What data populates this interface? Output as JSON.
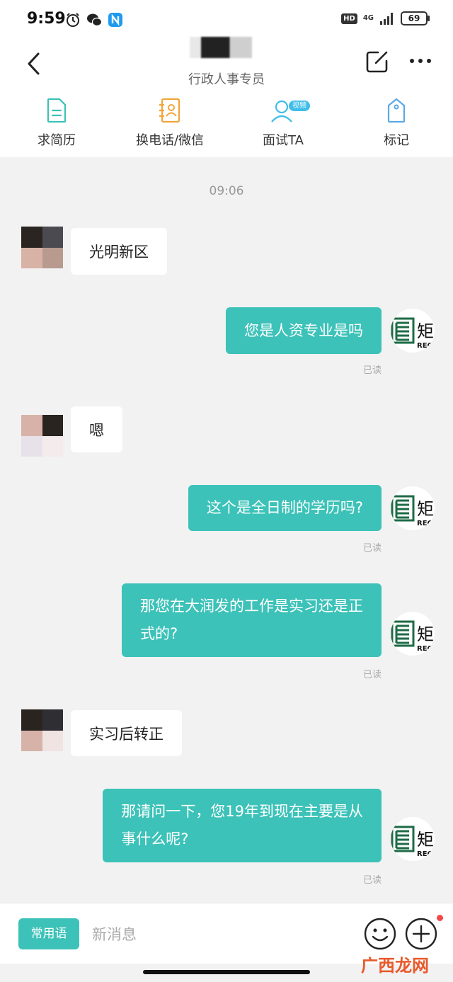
{
  "status_bar": {
    "time": "9:59",
    "network_hd": "HD",
    "network_type": "4G",
    "battery": "69",
    "icons": [
      "alarm-icon",
      "wechat-icon",
      "app-notification-icon",
      "signal-icon",
      "battery-icon"
    ]
  },
  "header": {
    "contact_role": "行政人事专员"
  },
  "actions": [
    {
      "label": "求简历",
      "icon": "resume-icon"
    },
    {
      "label": "换电话/微信",
      "icon": "contact-card-icon"
    },
    {
      "label": "面试TA",
      "icon": "interview-icon",
      "tag": "视频"
    },
    {
      "label": "标记",
      "icon": "tag-icon"
    }
  ],
  "chat": {
    "time": "09:06",
    "messages": [
      {
        "from": "candidate",
        "text": "光明新区"
      },
      {
        "from": "me",
        "text": "您是人资专业是吗",
        "status": "已读"
      },
      {
        "from": "candidate",
        "text": "嗯"
      },
      {
        "from": "me",
        "text": "这个是全日制的学历吗?",
        "status": "已读"
      },
      {
        "from": "me",
        "text_line1": "那您在大润发的工作是实习还是正",
        "text_line2": "式的?",
        "status": "已读"
      },
      {
        "from": "candidate",
        "text": "实习后转正"
      },
      {
        "from": "me",
        "text_line1": "那请问一下，您19年到现在主要是从",
        "text_line2": "事什么呢?",
        "status": "已读"
      }
    ],
    "my_avatar": {
      "glyph": "矩",
      "sub": "REC"
    }
  },
  "input_bar": {
    "phrases_label": "常用语",
    "placeholder": "新消息"
  },
  "watermark": "广西龙网",
  "colors": {
    "accent": "#3cc2b8",
    "background": "#f2f2f2",
    "read_tag": "#aaaaaa",
    "notification_dot": "#f24848"
  }
}
